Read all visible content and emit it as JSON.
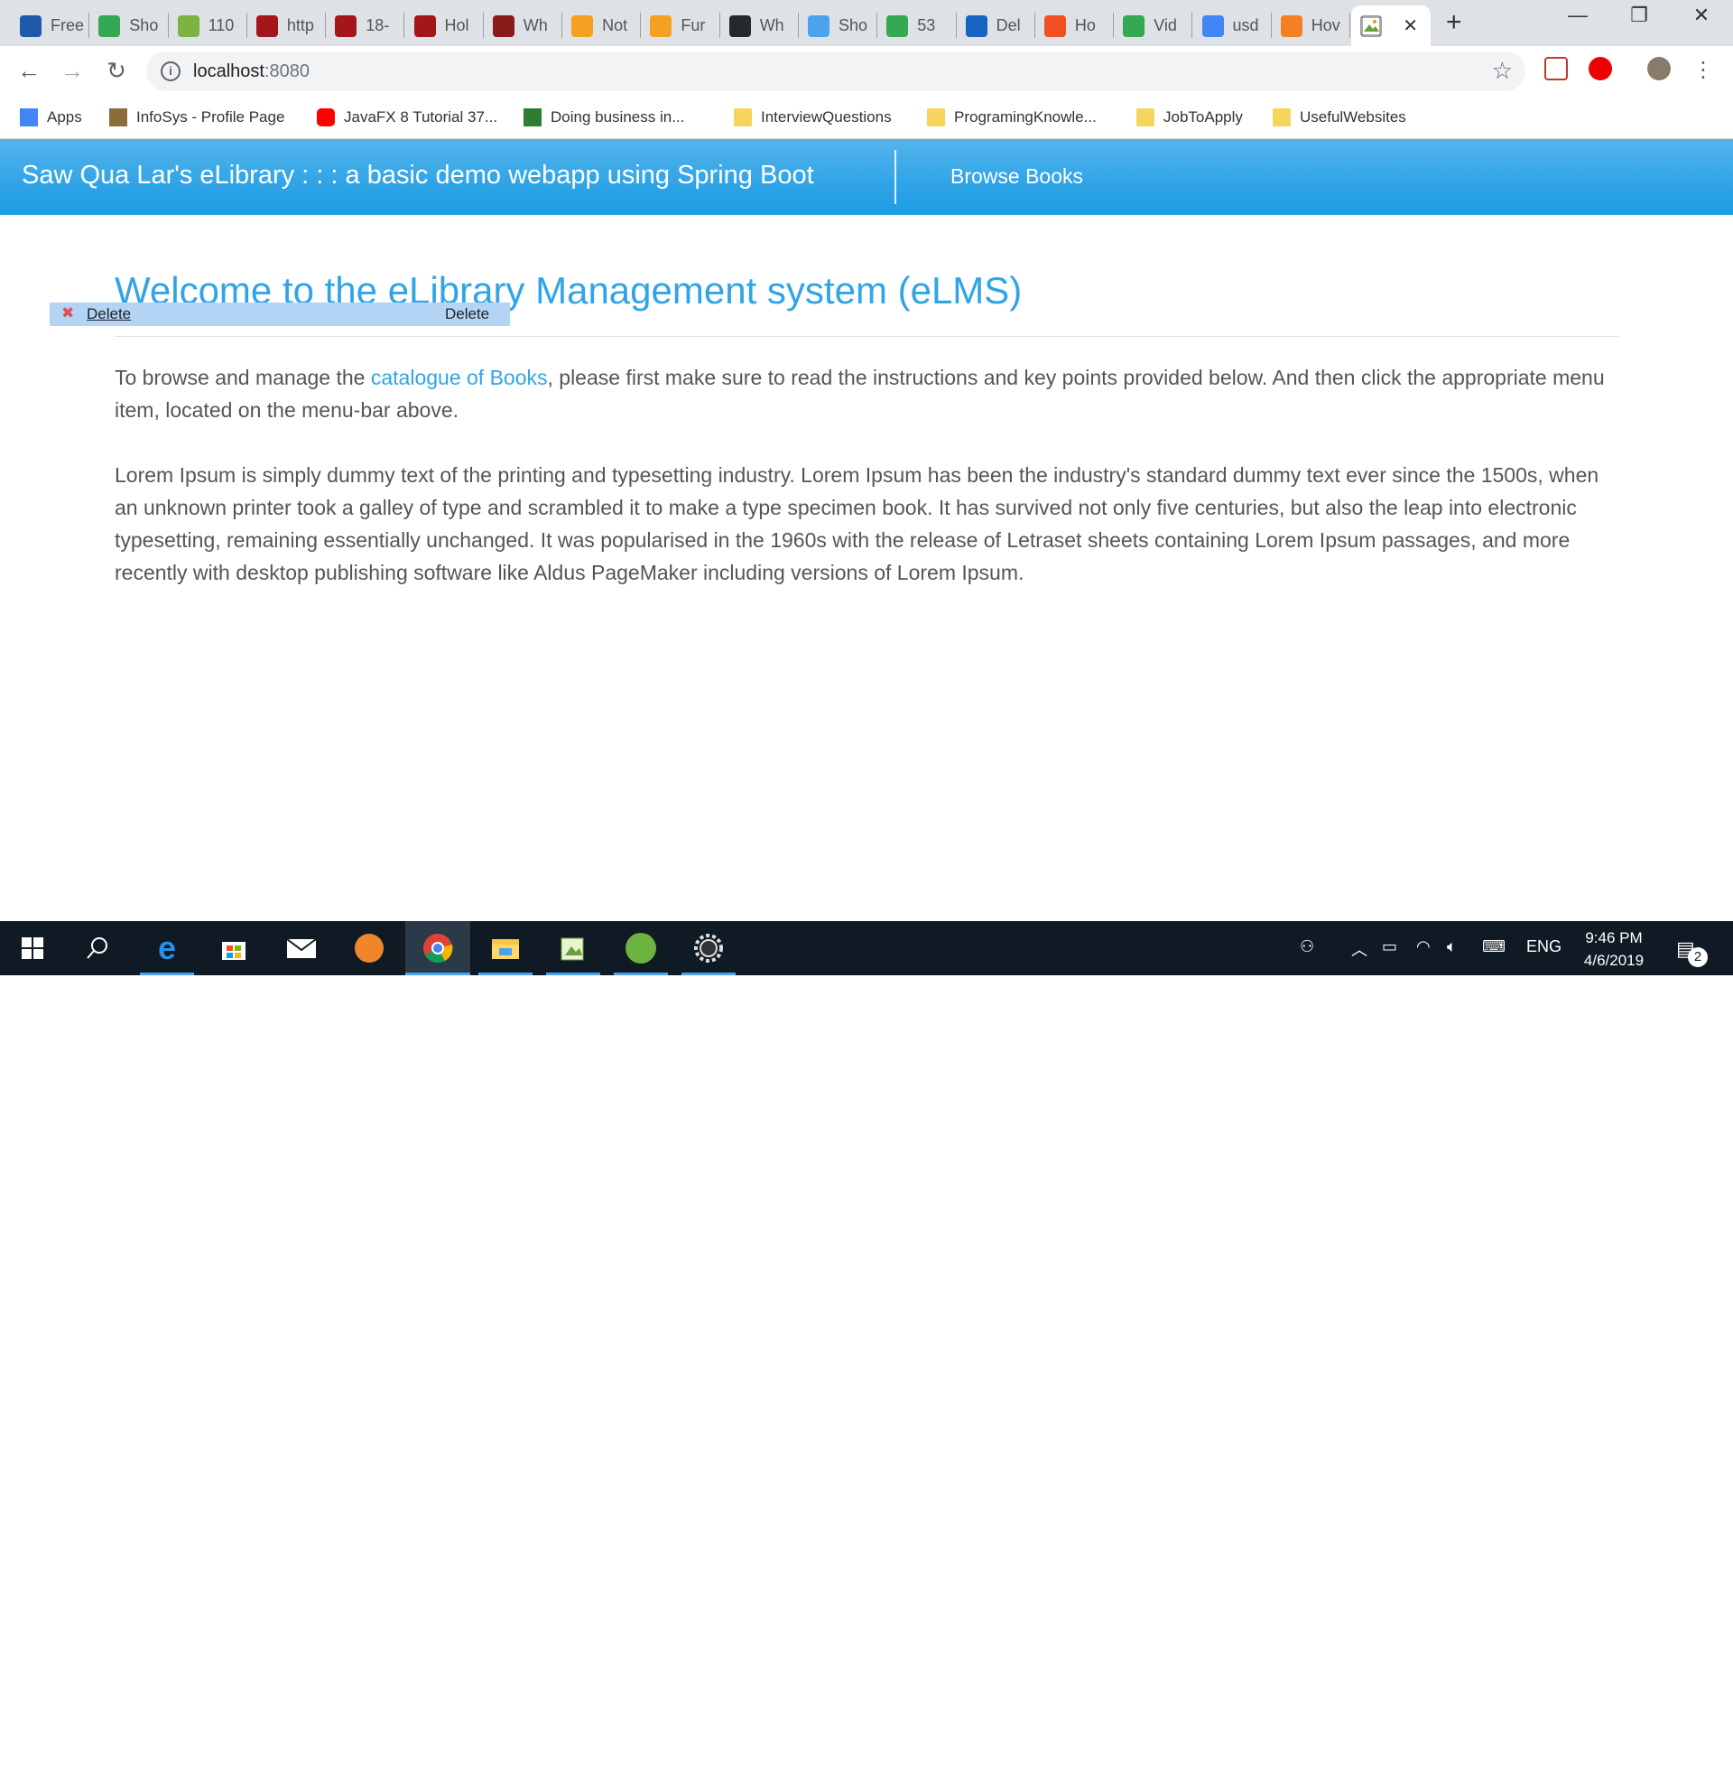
{
  "browser": {
    "tabs": [
      {
        "label": "Free",
        "icon": "sa-favicon",
        "color": "#1e5aa8"
      },
      {
        "label": "Sho",
        "icon": "maps-favicon",
        "color": "#34a853"
      },
      {
        "label": "110",
        "icon": "recycle-favicon",
        "color": "#7cb342"
      },
      {
        "label": "http",
        "icon": "ag-favicon",
        "color": "#a4161a"
      },
      {
        "label": "18-",
        "icon": "ag-favicon",
        "color": "#a4161a"
      },
      {
        "label": "Hol",
        "icon": "ag-favicon",
        "color": "#a4161a"
      },
      {
        "label": "Wh",
        "icon": "bus-favicon",
        "color": "#8b1a1a"
      },
      {
        "label": "Not",
        "icon": "s-favicon",
        "color": "#f4a020"
      },
      {
        "label": "Fur",
        "icon": "s-favicon",
        "color": "#f4a020"
      },
      {
        "label": "Wh",
        "icon": "github-favicon",
        "color": "#24292e"
      },
      {
        "label": "Sho",
        "icon": "house-favicon",
        "color": "#4aa3ec"
      },
      {
        "label": "53",
        "icon": "maps-favicon",
        "color": "#34a853"
      },
      {
        "label": "Del",
        "icon": "z-favicon",
        "color": "#1565c0"
      },
      {
        "label": "Ho",
        "icon": "microsoft-favicon",
        "color": "#f25022"
      },
      {
        "label": "Vid",
        "icon": "maps-favicon",
        "color": "#34a853"
      },
      {
        "label": "usd",
        "icon": "google-favicon",
        "color": "#4285f4"
      },
      {
        "label": "Hov",
        "icon": "stackoverflow-favicon",
        "color": "#f48024"
      }
    ],
    "active_tab_icon": "picture-favicon",
    "active_tab_close": "✕",
    "new_tab": "+",
    "window_controls": {
      "minimize": "—",
      "restore": "❐",
      "close": "✕"
    },
    "nav": {
      "back": "←",
      "forward": "→",
      "reload": "↻"
    },
    "url_host": "localhost",
    "url_port": ":8080",
    "url_info_icon": "i",
    "star": "☆",
    "bookmarks": [
      {
        "label": "Apps",
        "icon": "apps-grid-icon"
      },
      {
        "label": "InfoSys - Profile Page",
        "icon": "picture-icon"
      },
      {
        "label": "JavaFX 8 Tutorial 37...",
        "icon": "youtube-icon"
      },
      {
        "label": "Doing business in...",
        "icon": "star-grid-icon"
      },
      {
        "label": "InterviewQuestions",
        "icon": "folder-icon"
      },
      {
        "label": "ProgramingKnowle...",
        "icon": "folder-icon"
      },
      {
        "label": "JobToApply",
        "icon": "folder-icon"
      },
      {
        "label": "UsefulWebsites",
        "icon": "folder-icon"
      }
    ]
  },
  "app": {
    "brand": "Saw Qua Lar's eLibrary : : : a basic demo webapp using Spring Boot",
    "nav_link": "Browse Books",
    "title": "Welcome to the eLibrary Management system (eLMS)",
    "context_menu": {
      "item1": "Delete",
      "item2": "Delete"
    },
    "intro_before": "To browse and manage the ",
    "intro_link": "catalogue of Books",
    "intro_after": ", please first make sure to read the instructions and key points provided below. And then click the appropriate menu item, located on the menu-bar above.",
    "lorem": "Lorem Ipsum is simply dummy text of the printing and typesetting industry. Lorem Ipsum has been the industry's standard dummy text ever since the 1500s, when an unknown printer took a galley of type and scrambled it to make a type specimen book. It has survived not only five centuries, but also the leap into electronic typesetting, remaining essentially unchanged. It was popularised in the 1960s with the release of Letraset sheets containing Lorem Ipsum passages, and more recently with desktop publishing software like Aldus PageMaker including versions of Lorem Ipsum."
  },
  "taskbar": {
    "apps": [
      "windows-start-icon",
      "search-icon",
      "edge-icon",
      "store-icon",
      "mail-icon",
      "brave-icon",
      "chrome-icon",
      "file-explorer-icon",
      "notepad-icon",
      "spring-icon",
      "settings-gear-icon"
    ],
    "language": "ENG",
    "time": "9:46 PM",
    "date": "4/6/2019",
    "notifications": "2"
  },
  "colors": {
    "accent": "#2fa4e7",
    "taskbar": "#101a24"
  }
}
